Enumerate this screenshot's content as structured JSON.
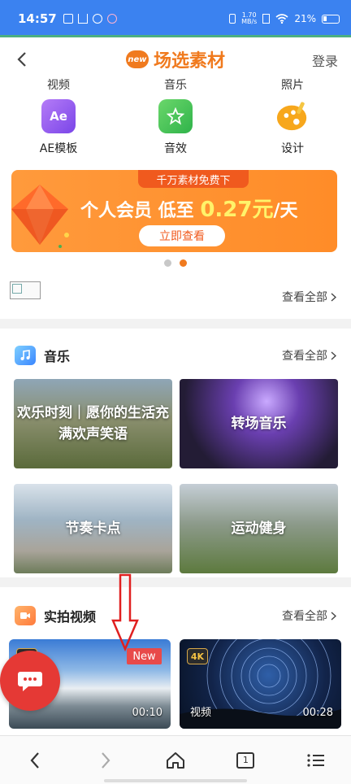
{
  "status_bar": {
    "time": "14:57",
    "net_speed_top": "1.70",
    "net_speed_bottom": "MB/s",
    "battery": "21%"
  },
  "header": {
    "logo_badge": "new",
    "title": "场选素材",
    "login": "登录"
  },
  "categories": {
    "partial_labels": [
      "视频",
      "音乐",
      "照片"
    ],
    "items": [
      {
        "icon": "ae-icon",
        "icon_text": "Ae",
        "label": "AE模板"
      },
      {
        "icon": "sound-effect-icon",
        "label": "音效"
      },
      {
        "icon": "design-palette-icon",
        "label": "设计"
      }
    ]
  },
  "banner": {
    "tag": "千万素材免费下",
    "text_prefix": "个人会员  低至 ",
    "price": "0.27元",
    "text_suffix": "/天",
    "button": "立即查看",
    "active_slide": 2,
    "slide_count": 2
  },
  "image_row": {
    "see_all": "查看全部"
  },
  "music": {
    "title": "音乐",
    "see_all": "查看全部",
    "tiles": [
      {
        "label": "欢乐时刻｜愿你的生活充满欢声笑语"
      },
      {
        "label": "转场音乐"
      },
      {
        "label": "节奏卡点"
      },
      {
        "label": "运动健身"
      }
    ]
  },
  "video": {
    "title": "实拍视频",
    "see_all": "查看全部",
    "tiles": [
      {
        "badge": "4K",
        "new_badge": "New",
        "duration": "00:10"
      },
      {
        "badge": "4K",
        "label": "视频",
        "duration": "00:28"
      }
    ]
  },
  "bottom_nav": {
    "tab_count": "1"
  },
  "colors": {
    "accent": "#f07a1e",
    "status_bar": "#3b82f0",
    "fab": "#e53935",
    "annotation": "#e02020"
  }
}
